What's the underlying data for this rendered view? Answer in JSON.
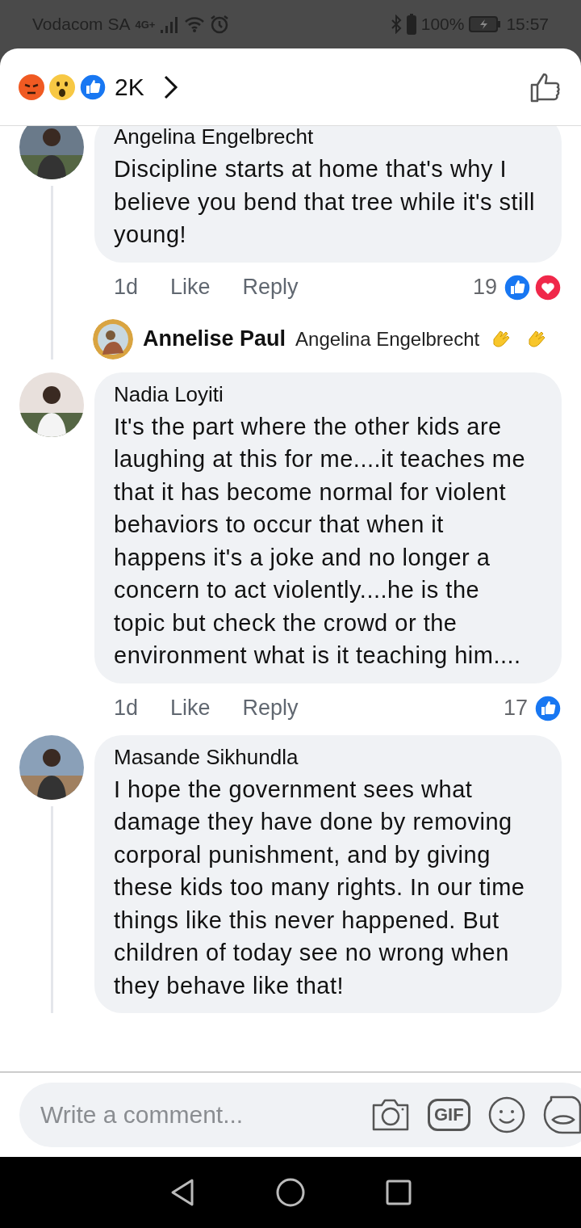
{
  "status_bar": {
    "carrier": "Vodacom SA",
    "network": "4G+",
    "battery": "100%",
    "time": "15:57"
  },
  "header": {
    "reaction_count": "2K"
  },
  "comments": [
    {
      "author": "Angelina Engelbrecht",
      "text": "Discipline starts at home that's why I believe you bend that tree while it's still young!",
      "time": "1d",
      "like": "Like",
      "reply": "Reply",
      "reaction_count": "19",
      "reactions": [
        {
          "kind": "like"
        },
        {
          "kind": "love"
        }
      ],
      "thread": true,
      "replies": [
        {
          "author": "Annelise Paul",
          "text": "Angelina Engelbrecht",
          "emoji": [
            {
              "kind": "clap"
            },
            {
              "kind": "clap"
            }
          ]
        }
      ]
    },
    {
      "author": "Nadia Loyiti",
      "text": "It's the part where the other kids are laughing at this for me....it teaches me that it has become normal for violent behaviors to occur that when it happens it's a joke and no longer a concern to act violently....he is the topic but check the crowd or the environment what is it teaching him....",
      "time": "1d",
      "like": "Like",
      "reply": "Reply",
      "reaction_count": "17",
      "reactions": [
        {
          "kind": "like"
        }
      ],
      "thread": false
    },
    {
      "author": "Masande Sikhundla",
      "text": "I hope the government sees what damage they have done by removing corporal punishment, and by giving these kids too many rights. In our time things like this never happened. But children of today see no wrong when they behave like that!",
      "thread": true
    }
  ],
  "composer": {
    "placeholder": "Write a comment...",
    "gif_label": "GIF"
  }
}
